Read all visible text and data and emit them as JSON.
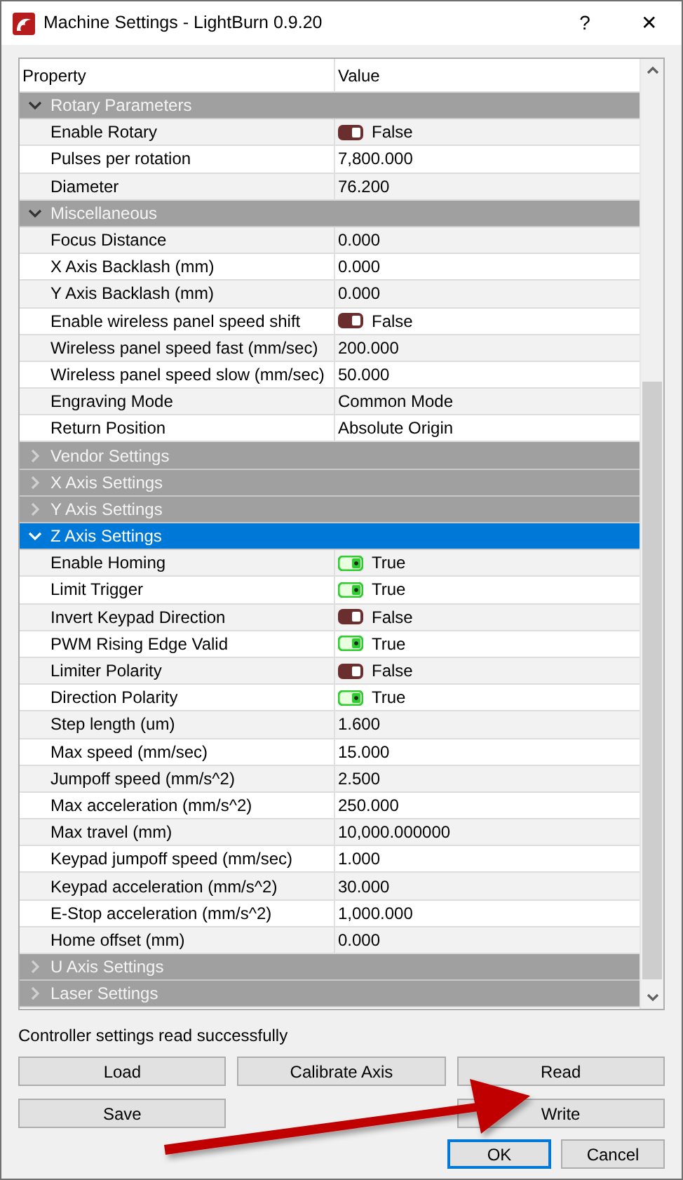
{
  "window": {
    "title": "Machine Settings - LightBurn 0.9.20",
    "help": "?",
    "close": "✕"
  },
  "table": {
    "columns": [
      "Property",
      "Value"
    ],
    "groups": [
      {
        "label": "Rotary Parameters",
        "expanded": true,
        "selected": false,
        "properties": [
          {
            "name": "Enable Rotary",
            "kind": "toggle",
            "on": false,
            "value": "False"
          },
          {
            "name": "Pulses per rotation",
            "kind": "text",
            "value": "7,800.000"
          },
          {
            "name": "Diameter",
            "kind": "text",
            "value": "76.200"
          }
        ]
      },
      {
        "label": "Miscellaneous",
        "expanded": true,
        "selected": false,
        "properties": [
          {
            "name": "Focus Distance",
            "kind": "text",
            "value": "0.000"
          },
          {
            "name": "X Axis Backlash (mm)",
            "kind": "text",
            "value": "0.000"
          },
          {
            "name": "Y Axis Backlash (mm)",
            "kind": "text",
            "value": "0.000"
          },
          {
            "name": "Enable wireless panel speed shift",
            "kind": "toggle",
            "on": false,
            "value": "False"
          },
          {
            "name": "Wireless panel speed fast (mm/sec)",
            "kind": "text",
            "value": "200.000"
          },
          {
            "name": "Wireless panel speed slow (mm/sec)",
            "kind": "text",
            "value": "50.000"
          },
          {
            "name": "Engraving Mode",
            "kind": "text",
            "value": "Common Mode"
          },
          {
            "name": "Return Position",
            "kind": "text",
            "value": "Absolute Origin"
          }
        ]
      },
      {
        "label": "Vendor Settings",
        "expanded": false,
        "selected": false
      },
      {
        "label": "X Axis Settings",
        "expanded": false,
        "selected": false
      },
      {
        "label": "Y Axis Settings",
        "expanded": false,
        "selected": false
      },
      {
        "label": "Z Axis Settings",
        "expanded": true,
        "selected": true,
        "properties": [
          {
            "name": "Enable Homing",
            "kind": "toggle",
            "on": true,
            "value": "True"
          },
          {
            "name": "Limit Trigger",
            "kind": "toggle",
            "on": true,
            "value": "True"
          },
          {
            "name": "Invert Keypad Direction",
            "kind": "toggle",
            "on": false,
            "value": "False"
          },
          {
            "name": "PWM Rising Edge Valid",
            "kind": "toggle",
            "on": true,
            "value": "True"
          },
          {
            "name": "Limiter Polarity",
            "kind": "toggle",
            "on": false,
            "value": "False"
          },
          {
            "name": "Direction Polarity",
            "kind": "toggle",
            "on": true,
            "value": "True"
          },
          {
            "name": "Step length (um)",
            "kind": "text",
            "value": "1.600"
          },
          {
            "name": "Max speed (mm/sec)",
            "kind": "text",
            "value": "15.000"
          },
          {
            "name": "Jumpoff speed (mm/s^2)",
            "kind": "text",
            "value": "2.500"
          },
          {
            "name": "Max acceleration (mm/s^2)",
            "kind": "text",
            "value": "250.000"
          },
          {
            "name": "Max travel (mm)",
            "kind": "text",
            "value": "10,000.000000"
          },
          {
            "name": "Keypad jumpoff speed (mm/sec)",
            "kind": "text",
            "value": "1.000"
          },
          {
            "name": "Keypad acceleration (mm/s^2)",
            "kind": "text",
            "value": "30.000"
          },
          {
            "name": "E-Stop acceleration (mm/s^2)",
            "kind": "text",
            "value": "1,000.000"
          },
          {
            "name": "Home offset (mm)",
            "kind": "text",
            "value": "0.000"
          }
        ]
      },
      {
        "label": "U Axis Settings",
        "expanded": false,
        "selected": false
      },
      {
        "label": "Laser Settings",
        "expanded": false,
        "selected": false
      }
    ]
  },
  "status": "Controller settings read successfully",
  "action_buttons": [
    {
      "left": "Load",
      "middle": "Calibrate Axis",
      "right": "Read"
    },
    {
      "left": "Save",
      "right": "Write"
    }
  ],
  "dialog_buttons": [
    {
      "label": "OK",
      "default": true
    },
    {
      "label": "Cancel",
      "default": false
    }
  ]
}
